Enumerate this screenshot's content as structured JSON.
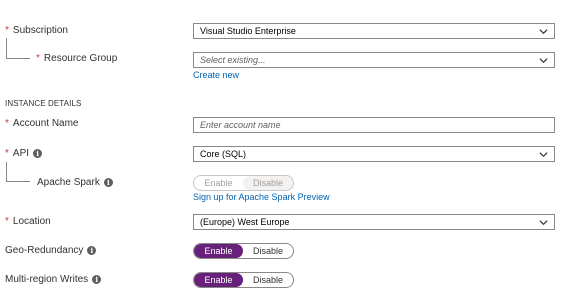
{
  "subscription": {
    "label": "Subscription",
    "value": "Visual Studio Enterprise"
  },
  "resource_group": {
    "label": "Resource Group",
    "placeholder": "Select existing...",
    "create_link": "Create new"
  },
  "instance_section": "INSTANCE DETAILS",
  "account_name": {
    "label": "Account Name",
    "placeholder": "Enter account name"
  },
  "api": {
    "label": "API",
    "value": "Core (SQL)"
  },
  "apache_spark": {
    "label": "Apache Spark",
    "enable": "Enable",
    "disable": "Disable",
    "link": "Sign up for Apache Spark Preview"
  },
  "location": {
    "label": "Location",
    "value": "(Europe) West Europe"
  },
  "geo_redundancy": {
    "label": "Geo-Redundancy",
    "enable": "Enable",
    "disable": "Disable",
    "selected": "Enable"
  },
  "multi_region": {
    "label": "Multi-region Writes",
    "enable": "Enable",
    "disable": "Disable",
    "selected": "Enable"
  },
  "colors": {
    "required": "#d13438",
    "accent": "#68217a",
    "link": "#0063b1"
  }
}
